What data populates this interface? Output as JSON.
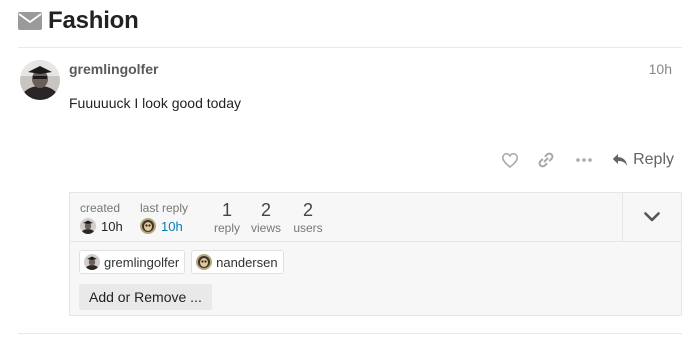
{
  "topic": {
    "title": "Fashion",
    "icon": "envelope-icon"
  },
  "post": {
    "username": "gremlingolfer",
    "date": "10h",
    "body": "Fuuuuuck I look good today",
    "actions": {
      "like_icon": "heart-icon",
      "link_icon": "link-icon",
      "more_icon": "ellipsis-icon",
      "reply_label": "Reply"
    }
  },
  "topic_map": {
    "created_label": "created",
    "created_time": "10h",
    "last_reply_label": "last reply",
    "last_reply_time": "10h",
    "replies": {
      "value": "1",
      "label": "reply"
    },
    "views": {
      "value": "2",
      "label": "views"
    },
    "users": {
      "value": "2",
      "label": "users"
    },
    "participants": [
      "gremlingolfer",
      "nandersen"
    ],
    "add_remove_label": "Add or Remove ...",
    "colors": {
      "link": "#0a7bb5",
      "background": "#f7f7f7"
    }
  }
}
